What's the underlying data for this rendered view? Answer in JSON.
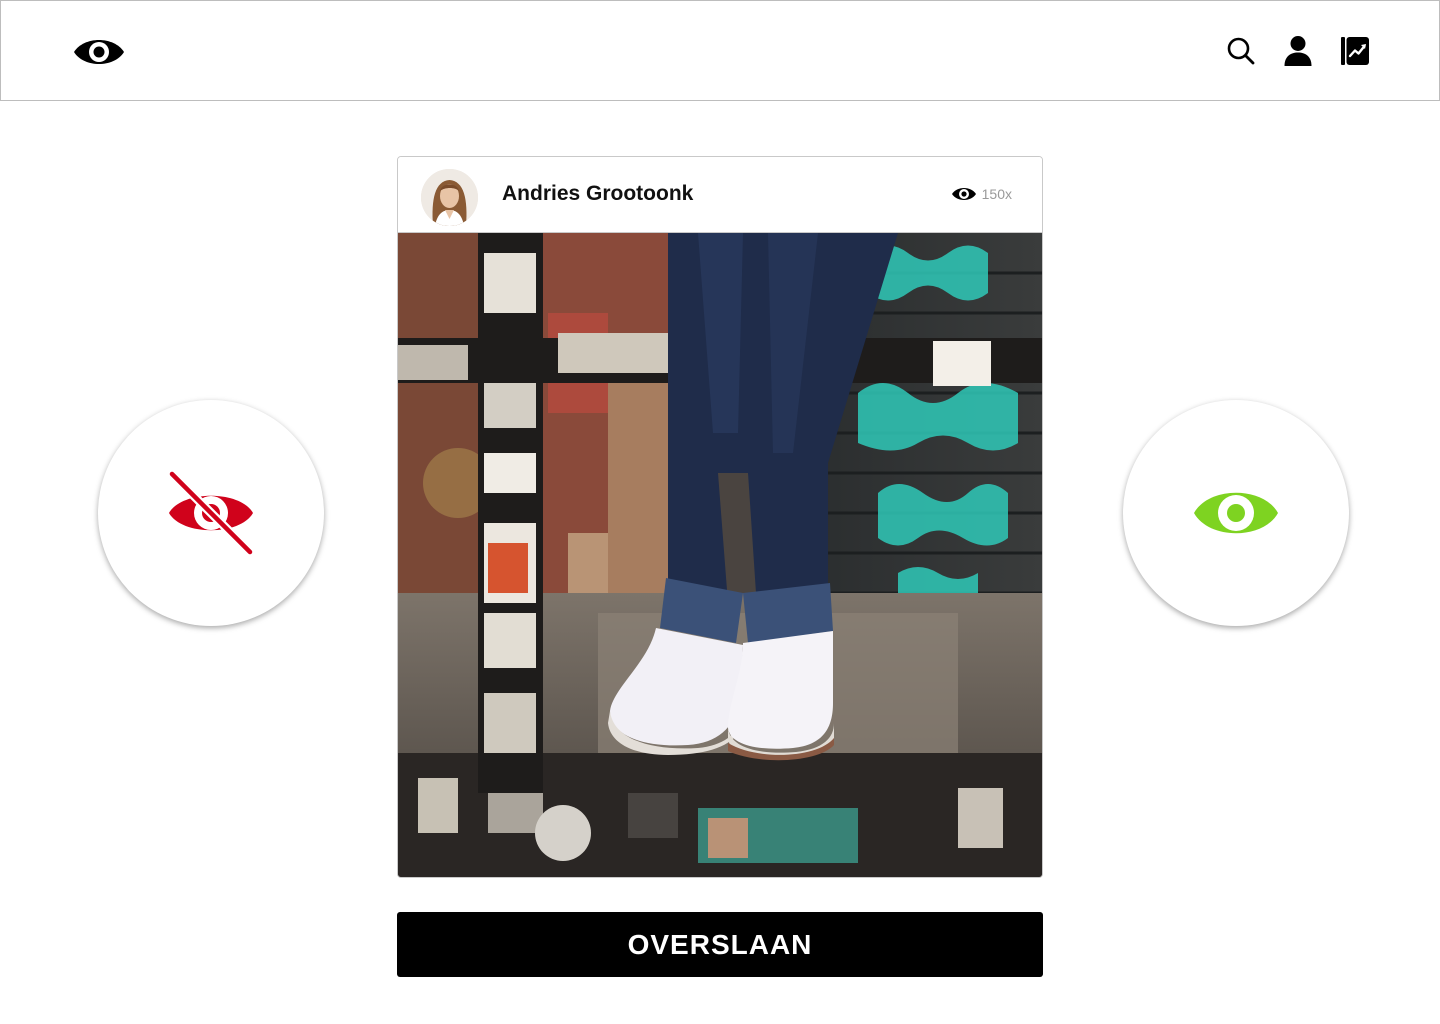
{
  "header": {
    "logo_icon": "eye-icon",
    "actions": [
      {
        "icon": "search-icon"
      },
      {
        "icon": "user-icon"
      },
      {
        "icon": "stats-book-icon"
      }
    ]
  },
  "post": {
    "username": "Andries Grootoonk",
    "views_count": "150x",
    "views_icon": "eye-icon",
    "avatar_icon": "avatar"
  },
  "actions": {
    "hide_icon": "eye-slash-icon",
    "hide_color": "#d0021b",
    "view_icon": "eye-icon",
    "view_color": "#7ed321"
  },
  "skip": {
    "label": "OVERSLAAN"
  }
}
